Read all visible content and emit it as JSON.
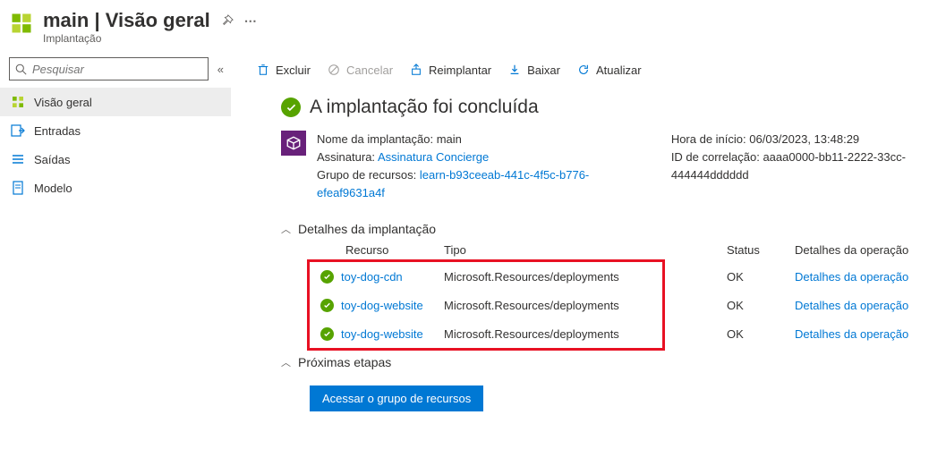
{
  "header": {
    "title": "main | Visão geral",
    "subtitle": "Implantação"
  },
  "sidebar": {
    "search_placeholder": "Pesquisar",
    "items": [
      {
        "label": "Visão geral",
        "icon": "overview"
      },
      {
        "label": "Entradas",
        "icon": "inputs"
      },
      {
        "label": "Saídas",
        "icon": "outputs"
      },
      {
        "label": "Modelo",
        "icon": "template"
      }
    ]
  },
  "toolbar": {
    "delete": "Excluir",
    "cancel": "Cancelar",
    "redeploy": "Reimplantar",
    "download": "Baixar",
    "refresh": "Atualizar"
  },
  "status": {
    "title": "A implantação foi concluída"
  },
  "info": {
    "deployment_name_label": "Nome da implantação:",
    "deployment_name": "main",
    "subscription_label": "Assinatura:",
    "subscription": "Assinatura Concierge",
    "resource_group_label": "Grupo de recursos:",
    "resource_group": "learn-b93ceeab-441c-4f5c-b776-efeaf9631a4f",
    "start_time_label": "Hora de início:",
    "start_time": "06/03/2023, 13:48:29",
    "correlation_label": "ID de correlação:",
    "correlation": "aaaa0000-bb11-2222-33cc-444444dddddd"
  },
  "sections": {
    "details": "Detalhes da implantação",
    "next": "Próximas etapas"
  },
  "grid": {
    "headers": {
      "resource": "Recurso",
      "type": "Tipo",
      "status": "Status",
      "details": "Detalhes da operação"
    },
    "rows": [
      {
        "resource": "toy-dog-cdn",
        "type": "Microsoft.Resources/deployments",
        "status": "OK",
        "details": "Detalhes da operação"
      },
      {
        "resource": "toy-dog-website",
        "type": "Microsoft.Resources/deployments",
        "status": "OK",
        "details": "Detalhes da operação"
      },
      {
        "resource": "toy-dog-website",
        "type": "Microsoft.Resources/deployments",
        "status": "OK",
        "details": "Detalhes da operação"
      }
    ]
  },
  "button": {
    "go_to_rg": "Acessar o grupo de recursos"
  }
}
